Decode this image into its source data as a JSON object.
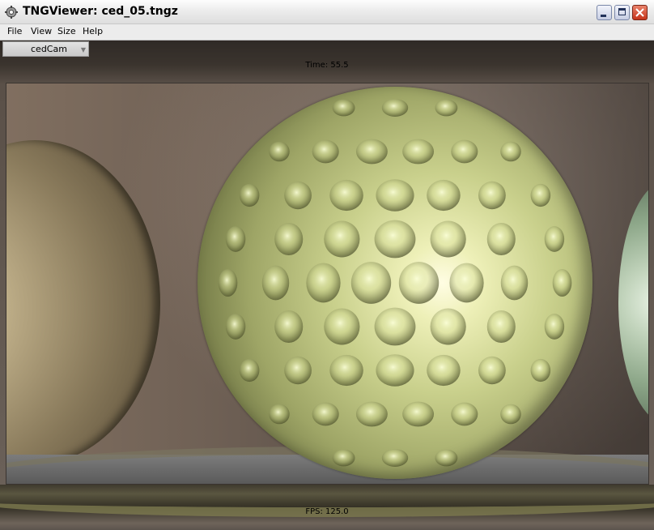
{
  "window": {
    "title": "TNGViewer: ced_05.tngz",
    "icon": "app-gear-icon",
    "controls": [
      "minimize-icon",
      "maximize-icon",
      "close-icon"
    ]
  },
  "menu": {
    "items": [
      "File",
      "View",
      "Size",
      "Help"
    ]
  },
  "viewer": {
    "camera": "cedCam",
    "time": "Time: 55.5",
    "fps": "FPS: 125.0"
  },
  "colors": {
    "close_button": "#c6341a",
    "sphere_main": "#c9d08c",
    "background": "#73665d"
  }
}
